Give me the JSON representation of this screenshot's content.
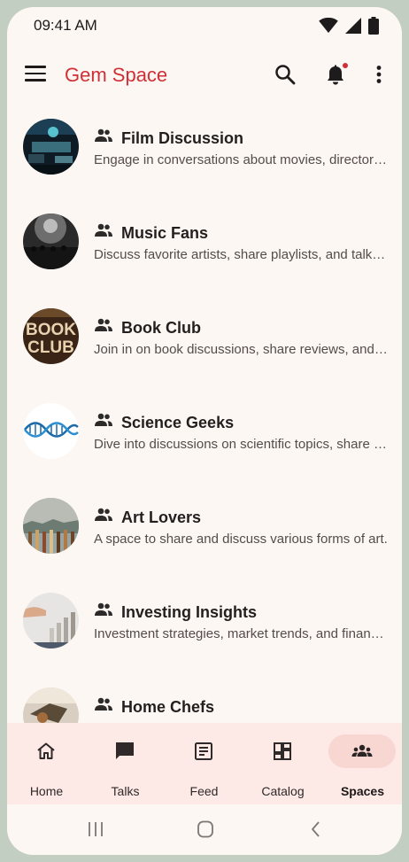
{
  "status_bar": {
    "time": "09:41 AM",
    "icons": [
      "wifi-icon",
      "signal-icon",
      "battery-icon"
    ]
  },
  "app_bar": {
    "title": "Gem Space",
    "title_color": "#cf3036",
    "actions": [
      "search-icon",
      "notification-bell-icon",
      "more-vert-icon"
    ],
    "notification_dot_color": "#cf3036"
  },
  "spaces": [
    {
      "title": "Film Discussion",
      "description": "Engage in conversations about movies, directors, and more."
    },
    {
      "title": "Music Fans",
      "description": "Discuss favorite artists, share playlists, and talk about new releases."
    },
    {
      "title": "Book Club",
      "description": "Join in on book discussions, share reviews, and reading recommendations."
    },
    {
      "title": "Science Geeks",
      "description": "Dive into discussions on scientific topics, share discoveries, and theories."
    },
    {
      "title": "Art Lovers",
      "description": "A space to share and discuss various forms of art."
    },
    {
      "title": "Investing Insights",
      "description": "Investment strategies, market trends, and financial tips."
    },
    {
      "title": "Home Chefs",
      "description": ""
    }
  ],
  "book_club_logo_text": [
    "BOOK",
    "CLUB"
  ],
  "bottom_nav": {
    "items": [
      {
        "label": "Home",
        "icon": "home-icon"
      },
      {
        "label": "Talks",
        "icon": "chat-icon"
      },
      {
        "label": "Feed",
        "icon": "article-icon"
      },
      {
        "label": "Catalog",
        "icon": "dashboard-icon"
      },
      {
        "label": "Spaces",
        "icon": "groups-icon"
      }
    ],
    "active": "Spaces"
  },
  "system_nav": [
    "recents-icon",
    "home-circle-icon",
    "back-icon"
  ]
}
